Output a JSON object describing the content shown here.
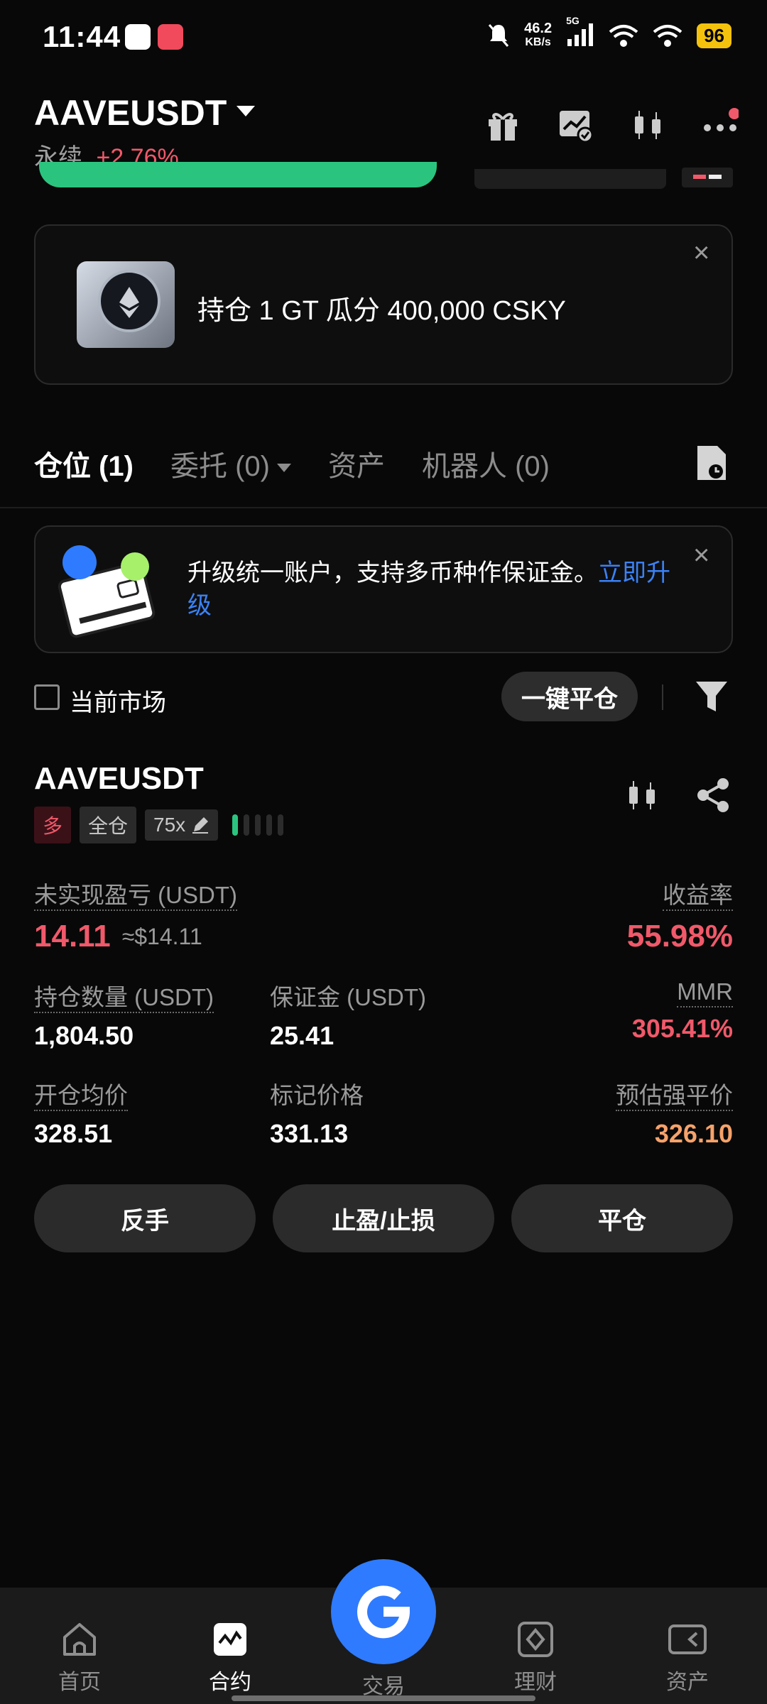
{
  "status_bar": {
    "time": "11:44",
    "net_speed_value": "46.2",
    "net_speed_unit": "KB/s",
    "network": "5G",
    "battery": "96"
  },
  "header": {
    "symbol": "AAVEUSDT",
    "contract_type": "永续",
    "change_pct": "+2.76%",
    "icons": [
      "gift-icon",
      "chart-check-icon",
      "candlestick-icon",
      "more-icon"
    ]
  },
  "promo_banner": {
    "text": "持仓 1 GT 瓜分 400,000 CSKY",
    "close": "×"
  },
  "tabs": [
    {
      "label": "仓位 (1)",
      "active": true
    },
    {
      "label": "委托 (0)",
      "active": false
    },
    {
      "label": "资产",
      "active": false
    },
    {
      "label": "机器人 (0)",
      "active": false
    }
  ],
  "upgrade_notice": {
    "text": "升级统一账户，支持多币种作保证金。",
    "link": "立即升级",
    "close": "×"
  },
  "filter": {
    "current_market": "当前市场",
    "close_all": "一键平仓"
  },
  "position": {
    "symbol": "AAVEUSDT",
    "side": "多",
    "margin_mode": "全仓",
    "leverage": "75x",
    "risk_level_bars": 5,
    "risk_level_active": 1,
    "unrealized_pnl_label": "未实现盈亏 (USDT)",
    "unrealized_pnl": "14.11",
    "unrealized_pnl_usd": "≈$14.11",
    "roe_label": "收益率",
    "roe": "55.98%",
    "size_label": "持仓数量 (USDT)",
    "size": "1,804.50",
    "margin_label": "保证金 (USDT)",
    "margin": "25.41",
    "mmr_label": "MMR",
    "mmr": "305.41%",
    "entry_label": "开仓均价",
    "entry": "328.51",
    "mark_label": "标记价格",
    "mark": "331.13",
    "liq_label": "预估强平价",
    "liq": "326.10"
  },
  "actions": {
    "reverse": "反手",
    "tp_sl": "止盈/止损",
    "close": "平仓"
  },
  "bottom_nav": [
    {
      "label": "首页",
      "icon": "home-icon"
    },
    {
      "label": "合约",
      "icon": "futures-icon",
      "active": true
    },
    {
      "label": "交易",
      "icon": "trade-icon"
    },
    {
      "label": "理财",
      "icon": "finance-icon"
    },
    {
      "label": "资产",
      "icon": "wallet-icon"
    }
  ],
  "colors": {
    "accent_blue": "#2f7bff",
    "profit_red": "#f0596a",
    "green": "#2bc47f",
    "liq_orange": "#f5a26b"
  }
}
